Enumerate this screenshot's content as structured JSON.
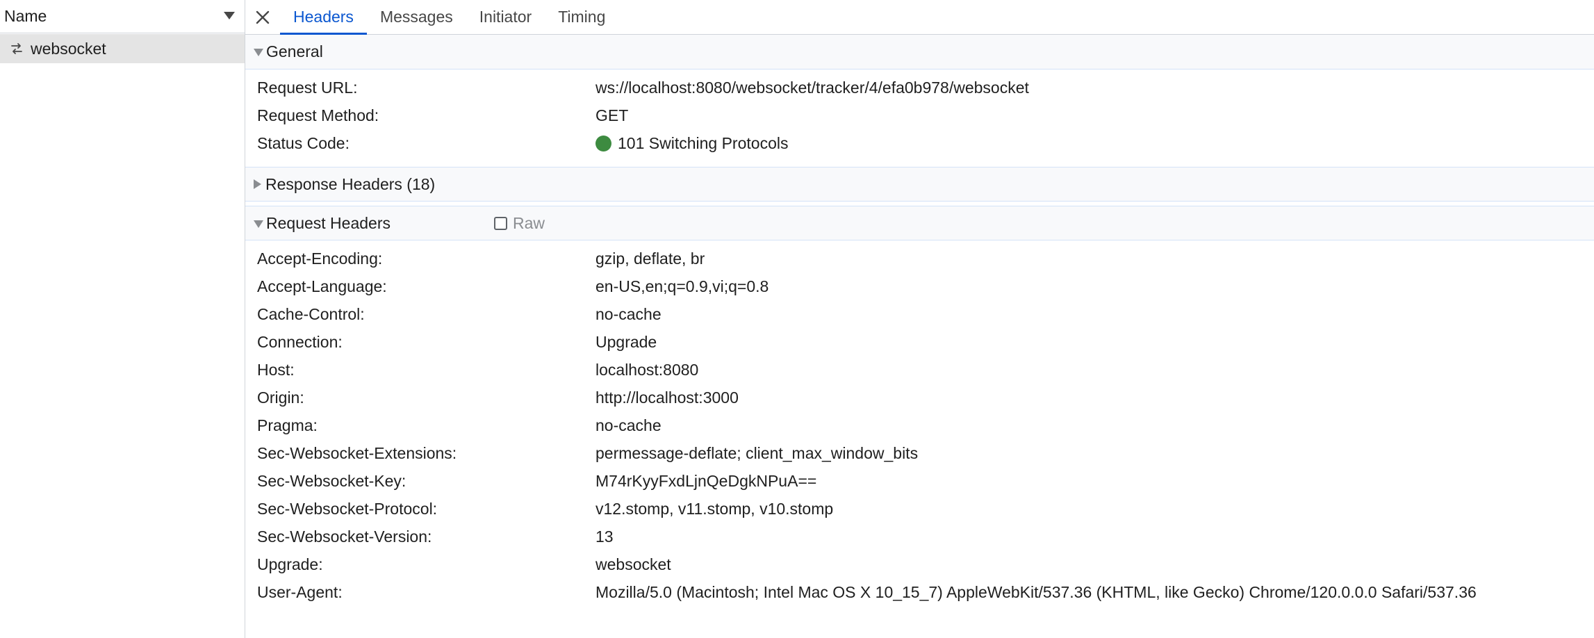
{
  "request_list": {
    "column_header": "Name",
    "items": [
      {
        "name": "websocket",
        "icon": "websocket-icon"
      }
    ]
  },
  "tabs": [
    {
      "label": "Headers",
      "active": true
    },
    {
      "label": "Messages",
      "active": false
    },
    {
      "label": "Initiator",
      "active": false
    },
    {
      "label": "Timing",
      "active": false
    }
  ],
  "general": {
    "title": "General",
    "rows": [
      {
        "key": "Request URL:",
        "value": "ws://localhost:8080/websocket/tracker/4/efa0b978/websocket"
      },
      {
        "key": "Request Method:",
        "value": "GET"
      },
      {
        "key": "Status Code:",
        "value": "101 Switching Protocols"
      }
    ],
    "status_color": "#3d8b40"
  },
  "response_headers": {
    "title": "Response Headers (18)"
  },
  "request_headers": {
    "title": "Request Headers",
    "raw_label": "Raw",
    "rows": [
      {
        "key": "Accept-Encoding:",
        "value": "gzip, deflate, br"
      },
      {
        "key": "Accept-Language:",
        "value": "en-US,en;q=0.9,vi;q=0.8"
      },
      {
        "key": "Cache-Control:",
        "value": "no-cache"
      },
      {
        "key": "Connection:",
        "value": "Upgrade"
      },
      {
        "key": "Host:",
        "value": "localhost:8080"
      },
      {
        "key": "Origin:",
        "value": "http://localhost:3000"
      },
      {
        "key": "Pragma:",
        "value": "no-cache"
      },
      {
        "key": "Sec-Websocket-Extensions:",
        "value": "permessage-deflate; client_max_window_bits"
      },
      {
        "key": "Sec-Websocket-Key:",
        "value": "M74rKyyFxdLjnQeDgkNPuA=="
      },
      {
        "key": "Sec-Websocket-Protocol:",
        "value": "v12.stomp, v11.stomp, v10.stomp"
      },
      {
        "key": "Sec-Websocket-Version:",
        "value": "13"
      },
      {
        "key": "Upgrade:",
        "value": "websocket"
      },
      {
        "key": "User-Agent:",
        "value": "Mozilla/5.0 (Macintosh; Intel Mac OS X 10_15_7) AppleWebKit/537.36 (KHTML, like Gecko) Chrome/120.0.0.0 Safari/537.36"
      }
    ]
  },
  "colors": {
    "accent": "#0b57d0",
    "selected_row": "#e4e4e4",
    "section_bg": "#f8f9fb"
  }
}
